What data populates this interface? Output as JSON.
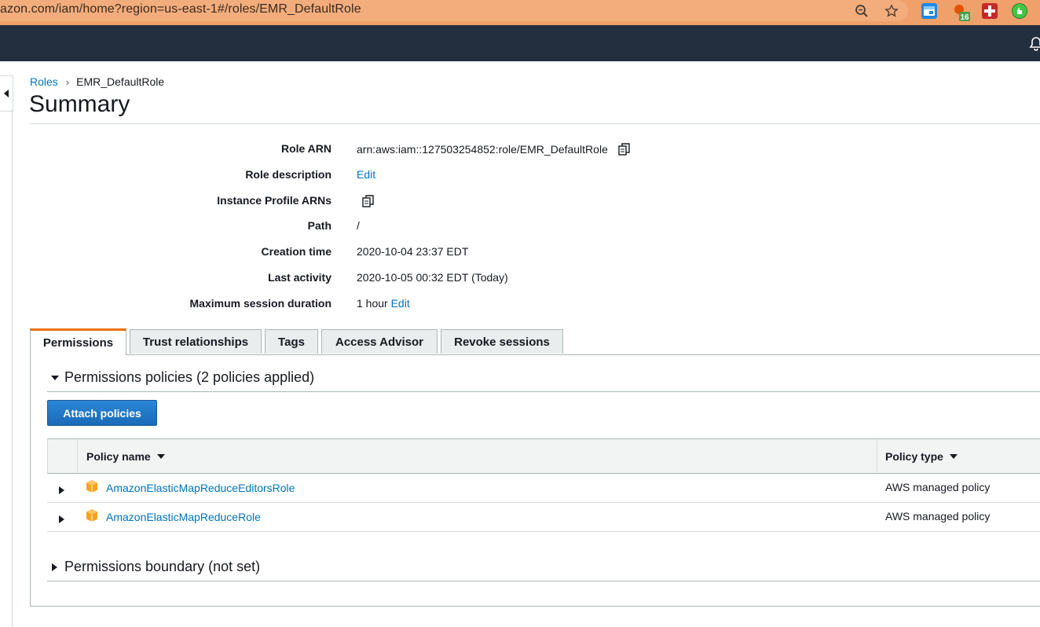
{
  "browser": {
    "url": "azon.com/iam/home?region=us-east-1#/roles/EMR_DefaultRole",
    "extension_badge": "16"
  },
  "breadcrumb": {
    "parent": "Roles",
    "separator": "›",
    "current": "EMR_DefaultRole"
  },
  "page_title": "Summary",
  "summary": {
    "role_arn_label": "Role ARN",
    "role_arn_value": "arn:aws:iam::127503254852:role/EMR_DefaultRole",
    "role_description_label": "Role description",
    "role_description_edit": "Edit",
    "instance_profile_label": "Instance Profile ARNs",
    "path_label": "Path",
    "path_value": "/",
    "creation_time_label": "Creation time",
    "creation_time_value": "2020-10-04 23:37 EDT",
    "last_activity_label": "Last activity",
    "last_activity_value": "2020-10-05 00:32 EDT (Today)",
    "max_session_label": "Maximum session duration",
    "max_session_value": "1 hour",
    "max_session_edit": "Edit"
  },
  "tabs": [
    {
      "label": "Permissions",
      "active": true
    },
    {
      "label": "Trust relationships",
      "active": false
    },
    {
      "label": "Tags",
      "active": false
    },
    {
      "label": "Access Advisor",
      "active": false
    },
    {
      "label": "Revoke sessions",
      "active": false
    }
  ],
  "permissions": {
    "policies_section_title": "Permissions policies (2 policies applied)",
    "attach_button": "Attach policies",
    "columns": {
      "policy_name": "Policy name",
      "policy_type": "Policy type"
    },
    "rows": [
      {
        "name": "AmazonElasticMapReduceEditorsRole",
        "type": "AWS managed policy"
      },
      {
        "name": "AmazonElasticMapReduceRole",
        "type": "AWS managed policy"
      }
    ],
    "boundary_section_title": "Permissions boundary (not set)"
  },
  "colors": {
    "accent_orange": "#ec7211",
    "link_blue": "#0073bb",
    "nav_dark": "#232f3e",
    "button_blue": "#1f73c3",
    "policy_icon_orange": "#f7a21b"
  }
}
